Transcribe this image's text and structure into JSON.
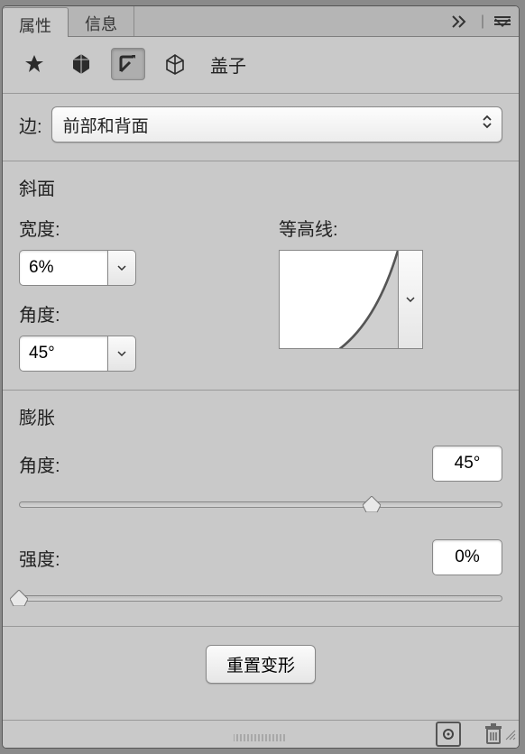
{
  "tabs": {
    "properties": "属性",
    "info": "信息"
  },
  "toolbar": {
    "title": "盖子"
  },
  "sides": {
    "label": "边:",
    "selected": "前部和背面"
  },
  "bevel": {
    "heading": "斜面",
    "width_label": "宽度:",
    "width_value": "6%",
    "angle_label": "角度:",
    "angle_value": "45°",
    "contour_label": "等高线:"
  },
  "inflate": {
    "heading": "膨胀",
    "angle_label": "角度:",
    "angle_value": "45°",
    "angle_slider_percent": 73,
    "strength_label": "强度:",
    "strength_value": "0%",
    "strength_slider_percent": 0
  },
  "actions": {
    "reset": "重置变形"
  }
}
